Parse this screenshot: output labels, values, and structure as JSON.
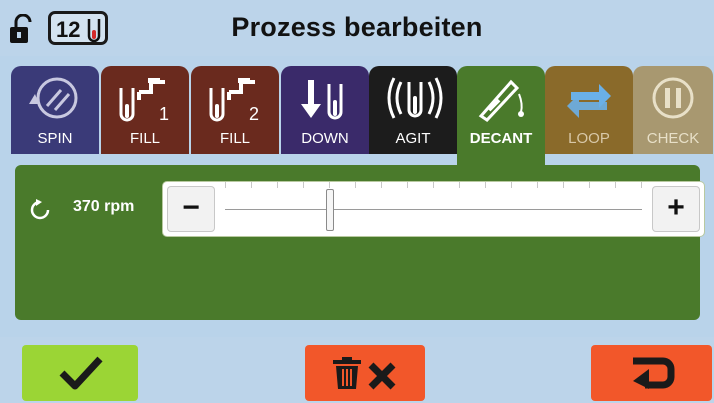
{
  "header": {
    "title": "Prozess bearbeiten",
    "badge_count": "12",
    "lock_icon": "unlocked-padlock-icon"
  },
  "tabs": [
    {
      "label": "SPIN",
      "icon": "spin-icon",
      "color": "#3a3a78",
      "active": false
    },
    {
      "label": "FILL",
      "sub": "1",
      "icon": "tap-tube-icon",
      "color": "#6a2a1e",
      "active": false
    },
    {
      "label": "FILL",
      "sub": "2",
      "icon": "tap-tube-icon",
      "color": "#6a2a1e",
      "active": false
    },
    {
      "label": "DOWN",
      "icon": "down-arrow-tube-icon",
      "color": "#3a2a6a",
      "active": false
    },
    {
      "label": "AGIT",
      "icon": "agitate-icon",
      "color": "#1c1c1c",
      "active": false
    },
    {
      "label": "DECANT",
      "icon": "decant-icon",
      "color": "#4a7a2b",
      "active": true
    },
    {
      "label": "LOOP",
      "icon": "loop-icon",
      "color": "#8a6a2a",
      "active": false
    },
    {
      "label": "CHECK",
      "icon": "pause-icon",
      "color": "#a89870",
      "active": false
    }
  ],
  "speed": {
    "label": "370 rpm",
    "value_fraction": 0.25,
    "minus_label": "−",
    "plus_label": "+"
  },
  "footer": {
    "confirm_icon": "checkmark-icon",
    "delete_icon": "trash-x-icon",
    "back_icon": "return-arrow-icon",
    "confirm_color": "#9bd535",
    "delete_color": "#f2572a",
    "back_color": "#f2572a"
  }
}
